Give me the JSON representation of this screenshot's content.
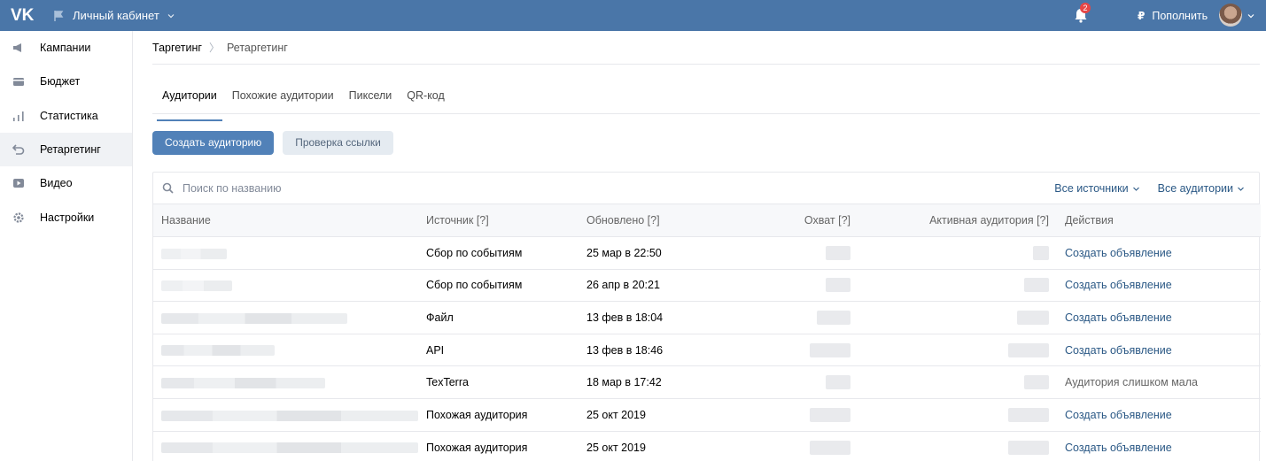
{
  "header": {
    "logo": "vk-logo",
    "cabinet_label": "Личный кабинет",
    "notifications_count": "2",
    "topup_currency": "₽",
    "topup_label": "Пополнить"
  },
  "sidebar": {
    "items": [
      {
        "label": "Кампании",
        "icon": "megaphone-icon"
      },
      {
        "label": "Бюджет",
        "icon": "wallet-icon"
      },
      {
        "label": "Статистика",
        "icon": "stats-icon"
      },
      {
        "label": "Ретаргетинг",
        "icon": "retarget-icon",
        "active": true
      },
      {
        "label": "Видео",
        "icon": "video-icon"
      },
      {
        "label": "Настройки",
        "icon": "settings-icon"
      }
    ]
  },
  "breadcrumb": {
    "root": "Таргетинг",
    "separator": "〉",
    "current": "Ретаргетинг"
  },
  "tabs": [
    {
      "label": "Аудитории",
      "active": true
    },
    {
      "label": "Похожие аудитории"
    },
    {
      "label": "Пиксели"
    },
    {
      "label": "QR-код"
    }
  ],
  "actions": {
    "create_audience": "Создать аудиторию",
    "check_link": "Проверка ссылки"
  },
  "search": {
    "placeholder": "Поиск по названию"
  },
  "filters": {
    "sources": "Все источники",
    "audiences": "Все аудитории"
  },
  "table": {
    "columns": {
      "name": "Название",
      "source": "Источник [?]",
      "updated": "Обновлено [?]",
      "reach": "Охват [?]",
      "active": "Активная аудитория [?]",
      "actions": "Действия"
    },
    "rows": [
      {
        "source": "Сбор по событиям",
        "updated": "25 мар в 22:50",
        "action": "Создать объявление",
        "action_link": true
      },
      {
        "source": "Сбор по событиям",
        "updated": "26 апр в 20:21",
        "action": "Создать объявление",
        "action_link": true
      },
      {
        "source": "Файл",
        "updated": "13 фев в 18:04",
        "action": "Создать объявление",
        "action_link": true
      },
      {
        "source": "API",
        "updated": "13 фев в 18:46",
        "action": "Создать объявление",
        "action_link": true
      },
      {
        "source": "TexTerra",
        "updated": "18 мар в 17:42",
        "action": "Аудитория слишком мала",
        "action_link": false
      },
      {
        "source": "Похожая аудитория",
        "updated": "25 окт 2019",
        "action": "Создать объявление",
        "action_link": true
      },
      {
        "source": "Похожая аудитория",
        "updated": "25 окт 2019",
        "action": "Создать объявление",
        "action_link": true
      }
    ]
  }
}
